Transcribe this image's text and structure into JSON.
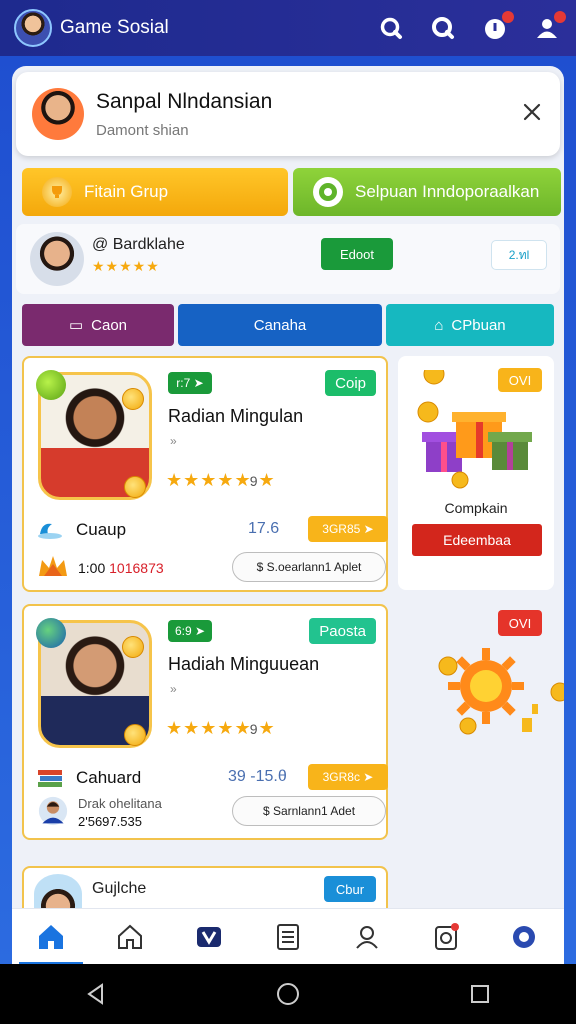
{
  "app": {
    "title": "Game Sosial"
  },
  "profile": {
    "name": "Sanpal Nlndansian",
    "subtitle": "Damont shian",
    "close_icon": "close-icon"
  },
  "actions": {
    "primary": "Fitain Grup",
    "secondary": "Selpuan Inndoporaalkan"
  },
  "user": {
    "name": "@ Bardklahe",
    "stars": "★★★★★",
    "button": "Edoot",
    "side_button": "2.ทl"
  },
  "tabs": [
    {
      "label": "Caon",
      "icon": "camera-icon"
    },
    {
      "label": "Canaha",
      "icon": ""
    },
    {
      "label": "CPbuan",
      "icon": "home-icon"
    }
  ],
  "offers": [
    {
      "tag_left": "r:7 ➤",
      "tag_right": "Coip",
      "title": "Radian Mingulan",
      "arrow": "»",
      "stars": "★★★★★",
      "rating": "9",
      "stars_tail": "★",
      "label": "Cuaup",
      "number": "17.6",
      "pill": "3GR85 ➤",
      "value_prefix": "1:00",
      "value_red": "1016873",
      "action": "$ S.oearlann1 Aplet"
    },
    {
      "tag_left": "6:9 ➤",
      "tag_right": "Paosta",
      "title": "Hadiah Minguuean",
      "arrow": "»",
      "stars": "★★★★★",
      "rating": "9",
      "stars_tail": "★",
      "label": "Cahuard",
      "number": "39 -15.θ",
      "pill": "3GR8c ➤",
      "value_small": "Drak ohelitana",
      "value_line": "2'5697.535",
      "action": "$ Sarnlann1 Adet"
    }
  ],
  "gift": {
    "tag": "OVI",
    "title": "Compkain",
    "button": "Edeembaa"
  },
  "sun": {
    "tag": "OVI"
  },
  "peek": {
    "label": "Gujlche",
    "button": "Cbur"
  },
  "bottom_nav": [
    {
      "icon": "home-filled-icon",
      "active": true
    },
    {
      "icon": "home-outline-icon",
      "active": false
    },
    {
      "icon": "v-logo-icon",
      "active": false
    },
    {
      "icon": "list-icon",
      "active": false
    },
    {
      "icon": "profile-icon",
      "active": false
    },
    {
      "icon": "notification-icon",
      "active": false
    },
    {
      "icon": "settings-icon",
      "active": false
    }
  ],
  "colors": {
    "accent": "#1a74e0",
    "topbar": "#1e2a8e",
    "gold": "#f6a90f",
    "red": "#d3261c",
    "green": "#1a9a3a"
  }
}
